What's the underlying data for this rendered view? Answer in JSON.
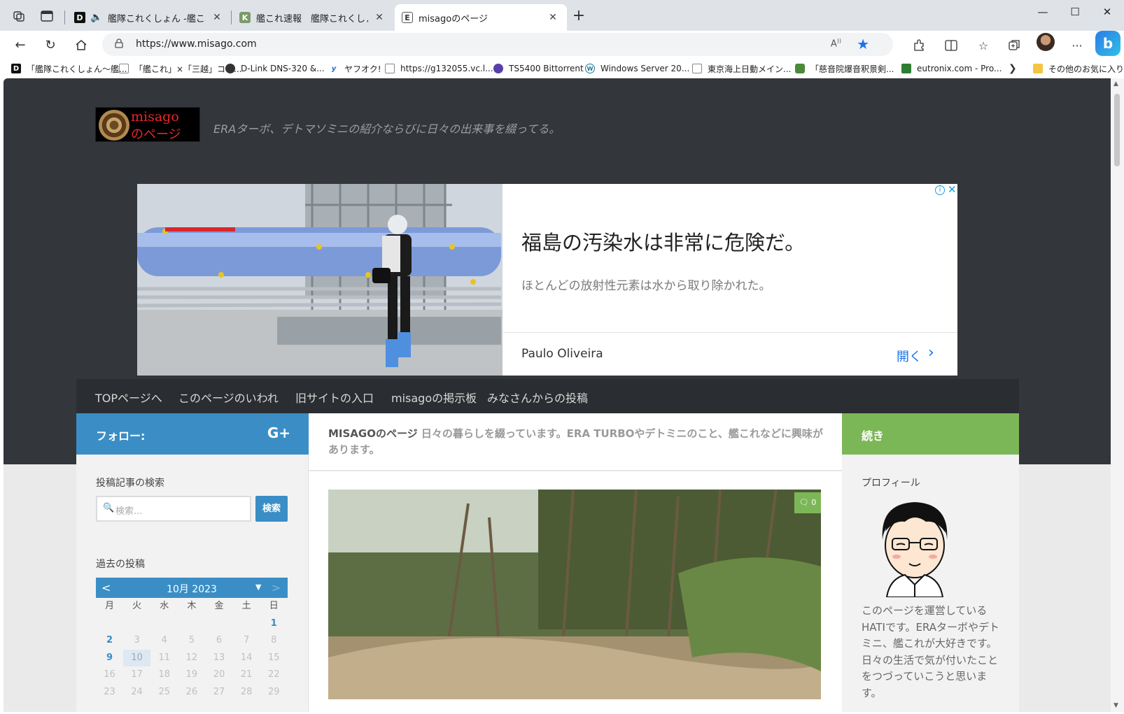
{
  "tabs": [
    {
      "title": "艦隊これくしょん -艦これ- - オン",
      "favicon": "D",
      "audio": true
    },
    {
      "title": "艦これ速報　艦隊これくしょんまとめ",
      "favicon": "K"
    },
    {
      "title": "misagoのページ",
      "favicon": "E",
      "active": true
    }
  ],
  "address": {
    "url": "https://www.misago.com"
  },
  "bookmarks": [
    {
      "label": "「艦隊これくしょん〜艦...",
      "icon": "D"
    },
    {
      "label": "「艦これ」×「三越」コラ...",
      "icon": "page"
    },
    {
      "label": "D-Link DNS-320 &...",
      "icon": "dlink"
    },
    {
      "label": "ヤフオク!",
      "icon": "yahoo"
    },
    {
      "label": "https://g132055.vc.l...",
      "icon": "page"
    },
    {
      "label": "TS5400 Bittorrent",
      "icon": "bt"
    },
    {
      "label": "Windows Server 20...",
      "icon": "wp"
    },
    {
      "label": "東京海上日動メイン...",
      "icon": "page"
    },
    {
      "label": "「慈音院爆音釈景剣...",
      "icon": "green"
    },
    {
      "label": "eutronix.com - Pro...",
      "icon": "green2"
    }
  ],
  "bookmarks_other": "その他のお気に入り",
  "site": {
    "logo": {
      "line1": "misago",
      "line2": "のページ"
    },
    "tagline": "ERAターボ、デトマソミニの紹介ならびに日々の出来事を綴ってる。"
  },
  "ad": {
    "headline": "福島の汚染水は非常に危険だ。",
    "description": "ほとんどの放射性元素は水から取り除かれた。",
    "advertiser": "Paulo Oliveira",
    "open_label": "開く"
  },
  "menu": [
    "TOPページへ",
    "このページのいわれ",
    "旧サイトの入口",
    "misagoの掲示板",
    "みなさんからの投稿"
  ],
  "follow_label": "フォロー:",
  "header_title": {
    "site": "MISAGOのページ",
    "rest": " 日々の暮らしを綴っています。ERA TURBOやデトミニのこと、艦これなどに興味があります。"
  },
  "continue_label": "続き",
  "search": {
    "heading": "投稿記事の検索",
    "placeholder": "検索...",
    "button": "検索"
  },
  "calendar": {
    "heading": "過去の投稿",
    "month": "10月 2023",
    "prev": "<",
    "next": ">",
    "dow": [
      "月",
      "火",
      "水",
      "木",
      "金",
      "土",
      "日"
    ],
    "weeks": [
      [
        "",
        "",
        "",
        "",
        "",
        "",
        "1"
      ],
      [
        "2",
        "3",
        "4",
        "5",
        "6",
        "7",
        "8"
      ],
      [
        "9",
        "10",
        "11",
        "12",
        "13",
        "14",
        "15"
      ],
      [
        "16",
        "17",
        "18",
        "19",
        "20",
        "21",
        "22"
      ],
      [
        "23",
        "24",
        "25",
        "26",
        "27",
        "28",
        "29"
      ]
    ],
    "linked_days": [
      "1",
      "2",
      "9"
    ],
    "today": "10"
  },
  "post": {
    "comment_count": "0"
  },
  "profile": {
    "heading": "プロフィール",
    "text": "このページを運営しているHATIです。ERAターボやデトミニ、艦これが大好きです。日々の生活で気が付いたことをつづっていこうと思います。"
  }
}
